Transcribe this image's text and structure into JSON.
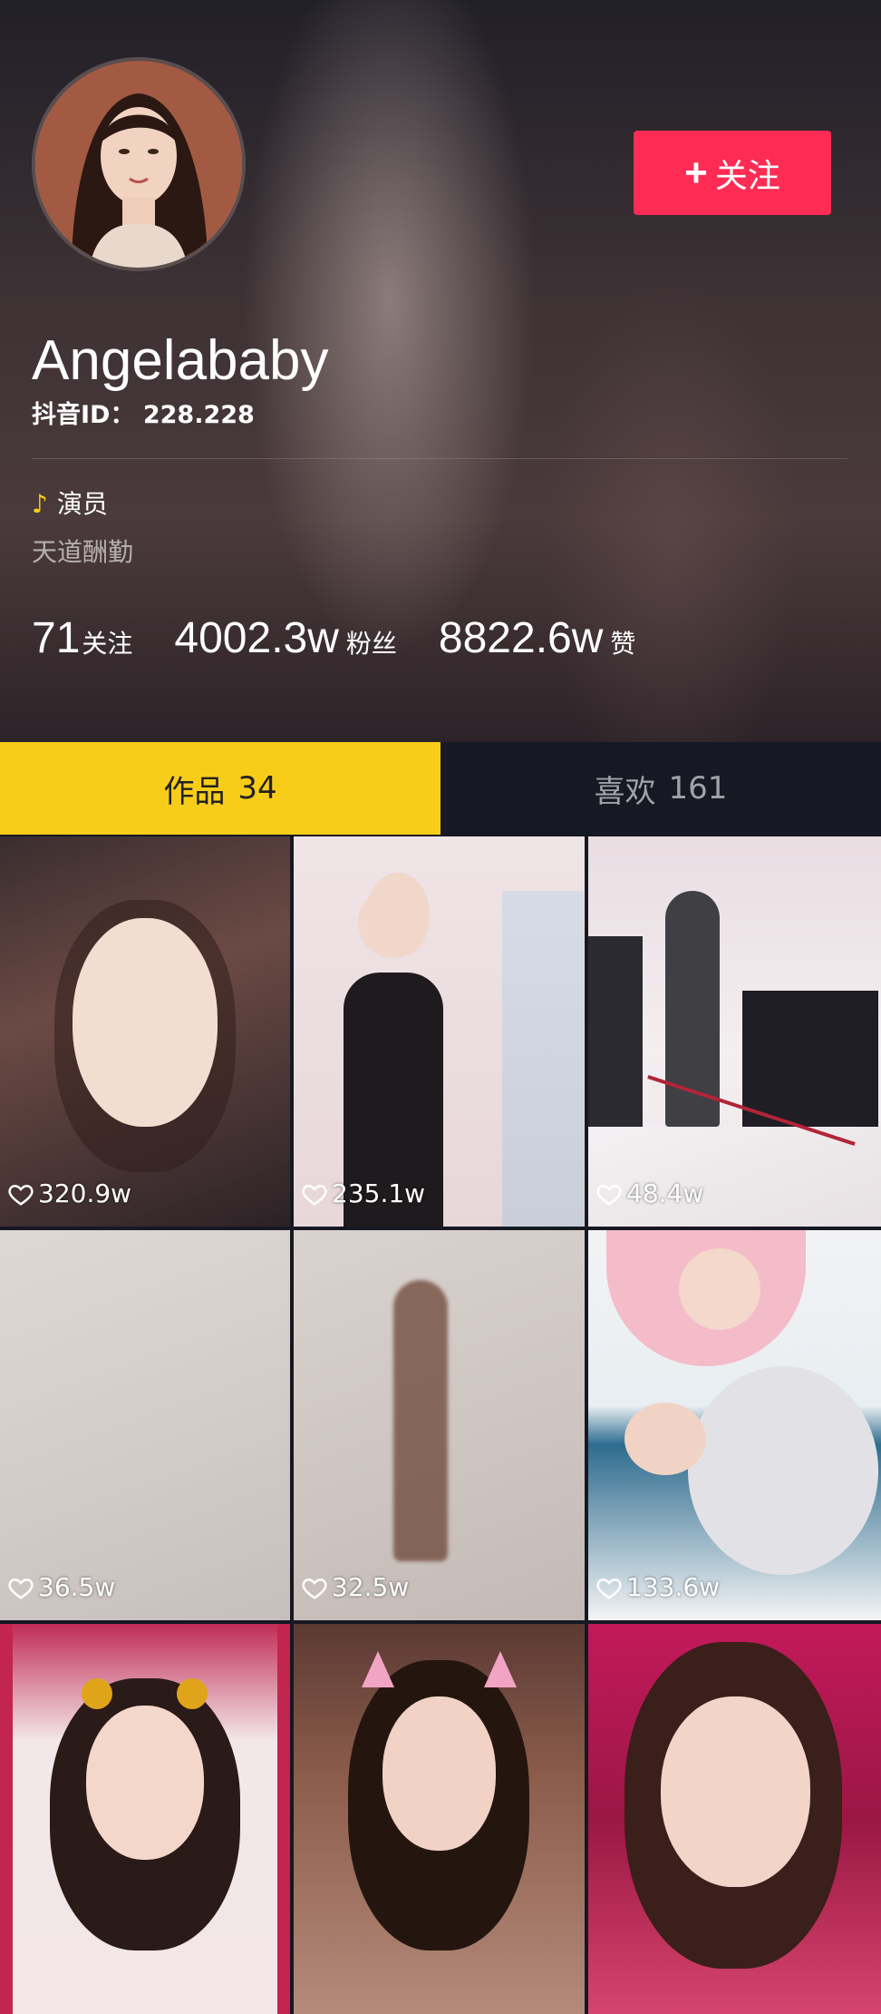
{
  "profile": {
    "nickname": "Angelababy",
    "douyin_id": "抖音ID：  228.228",
    "role": "演员",
    "signature": "天道酬勤",
    "follow_button": "关注"
  },
  "stats": [
    {
      "number": "71",
      "label": "关注"
    },
    {
      "number": "4002.3w",
      "label": "粉丝"
    },
    {
      "number": "8822.6w",
      "label": "赞"
    }
  ],
  "tabs": [
    {
      "label": "作品",
      "count": "34"
    },
    {
      "label": "喜欢",
      "count": "161"
    }
  ],
  "videos": [
    {
      "likes": "320.9w"
    },
    {
      "likes": "235.1w"
    },
    {
      "likes": "48.4w"
    },
    {
      "likes": "36.5w"
    },
    {
      "likes": "32.5w"
    },
    {
      "likes": "133.6w"
    },
    {
      "likes": ""
    },
    {
      "likes": ""
    },
    {
      "likes": ""
    }
  ],
  "colors": {
    "accent_red": "#fe2c55",
    "active_tab": "#f8cd19",
    "background": "#161823"
  },
  "icons": {
    "plus": "plus-icon",
    "douyin_note": "douyin-note-icon",
    "heart": "heart-icon"
  }
}
